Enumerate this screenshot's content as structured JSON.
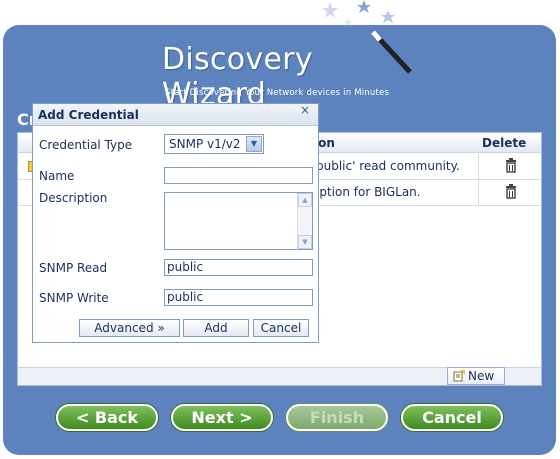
{
  "header": {
    "title": "Discovery Wizard",
    "subtitle": "Start Discovering Your Network devices in Minutes"
  },
  "section": {
    "title_partial": "Cr"
  },
  "table": {
    "columns": {
      "description": "ion",
      "delete": "Delete"
    },
    "rows": [
      {
        "description": "public' read community."
      },
      {
        "description": "iption for BIGLan."
      }
    ]
  },
  "panel": {
    "new_label": "New"
  },
  "footer": {
    "back_label": "< Back",
    "next_label": "Next >",
    "finish_label": "Finish",
    "cancel_label": "Cancel"
  },
  "dialog": {
    "title": "Add Credential",
    "close_glyph": "×",
    "credential_type_label": "Credential Type",
    "credential_type_value": "SNMP v1/v2",
    "name_label": "Name",
    "name_value": "",
    "description_label": "Description",
    "description_value": "",
    "snmp_read_label": "SNMP Read",
    "snmp_read_value": "public",
    "snmp_write_label": "SNMP Write",
    "snmp_write_value": "public",
    "advanced_label": "Advanced »",
    "add_label": "Add",
    "cancel_label": "Cancel"
  },
  "colors": {
    "frame": "#5d83be",
    "button_green": "#4d9a2b",
    "text_dark": "#1a2f5a"
  }
}
